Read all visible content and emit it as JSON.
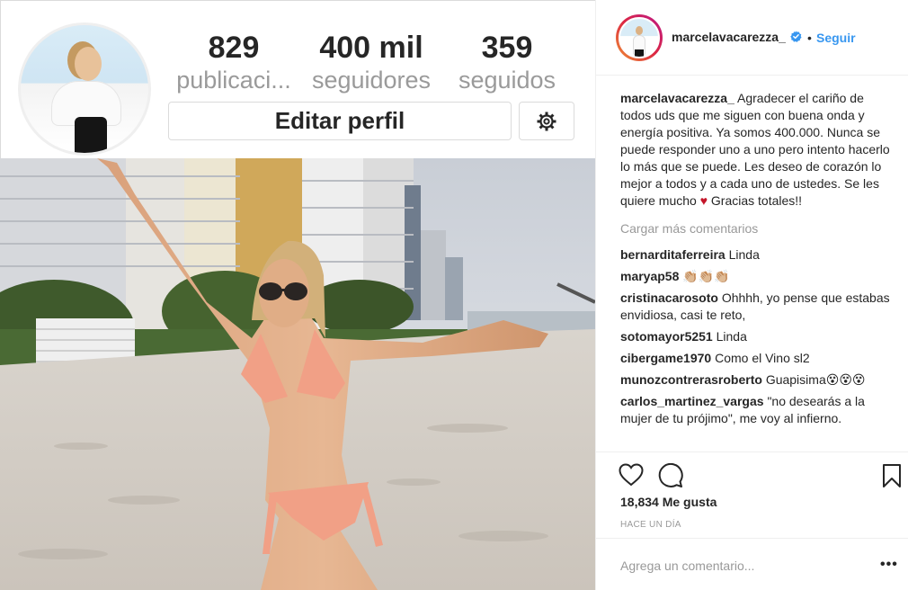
{
  "profile": {
    "stats": [
      {
        "value": "829",
        "label": "publicaci..."
      },
      {
        "value": "400 mil",
        "label": "seguidores"
      },
      {
        "value": "359",
        "label": "seguidos"
      }
    ],
    "edit_label": "Editar perfil"
  },
  "post": {
    "username": "marcelavacarezza_",
    "separator": "•",
    "follow_label": "Seguir",
    "caption_username": "marcelavacarezza_",
    "caption_text": "Agradecer el cariño de todos uds que me siguen con buena onda y energía positiva. Ya somos 400.000. Nunca se puede responder uno a uno pero intento hacerlo lo más que se puede. Les deseo de corazón lo mejor a todos y a cada uno de ustedes. Se les quiere mucho",
    "caption_heart": "♥",
    "caption_end": "Gracias totales!!",
    "load_more": "Cargar más comentarios",
    "comments": [
      {
        "user": "bernarditaferreira",
        "text": "Linda"
      },
      {
        "user": "maryap58",
        "text": "👏🏼👏🏼👏🏼"
      },
      {
        "user": "cristinacarosoto",
        "text": "Ohhhh, yo pense que estabas envidiosa, casi te reto,"
      },
      {
        "user": "sotomayor5251",
        "text": "Linda"
      },
      {
        "user": "cibergame1970",
        "text": "Como el Vino sl2"
      },
      {
        "user": "munozcontrerasroberto",
        "text": "Guapisima😵😵😵"
      },
      {
        "user": "carlos_martinez_vargas",
        "text": "\"no desearás a la mujer de tu prójimo\", me voy al infierno."
      }
    ],
    "likes": "18,834 Me gusta",
    "time": "HACE UN DÍA",
    "comment_placeholder": "Agrega un comentario...",
    "more_label": "•••"
  },
  "icons": {
    "settings": "gear-icon",
    "verified": "verified-badge-icon",
    "like": "heart-icon",
    "comment": "comment-icon",
    "save": "bookmark-icon",
    "more": "more-options-icon"
  },
  "colors": {
    "link": "#3897f0",
    "muted": "#999999",
    "text": "#262626",
    "heart": "#c4162a"
  }
}
